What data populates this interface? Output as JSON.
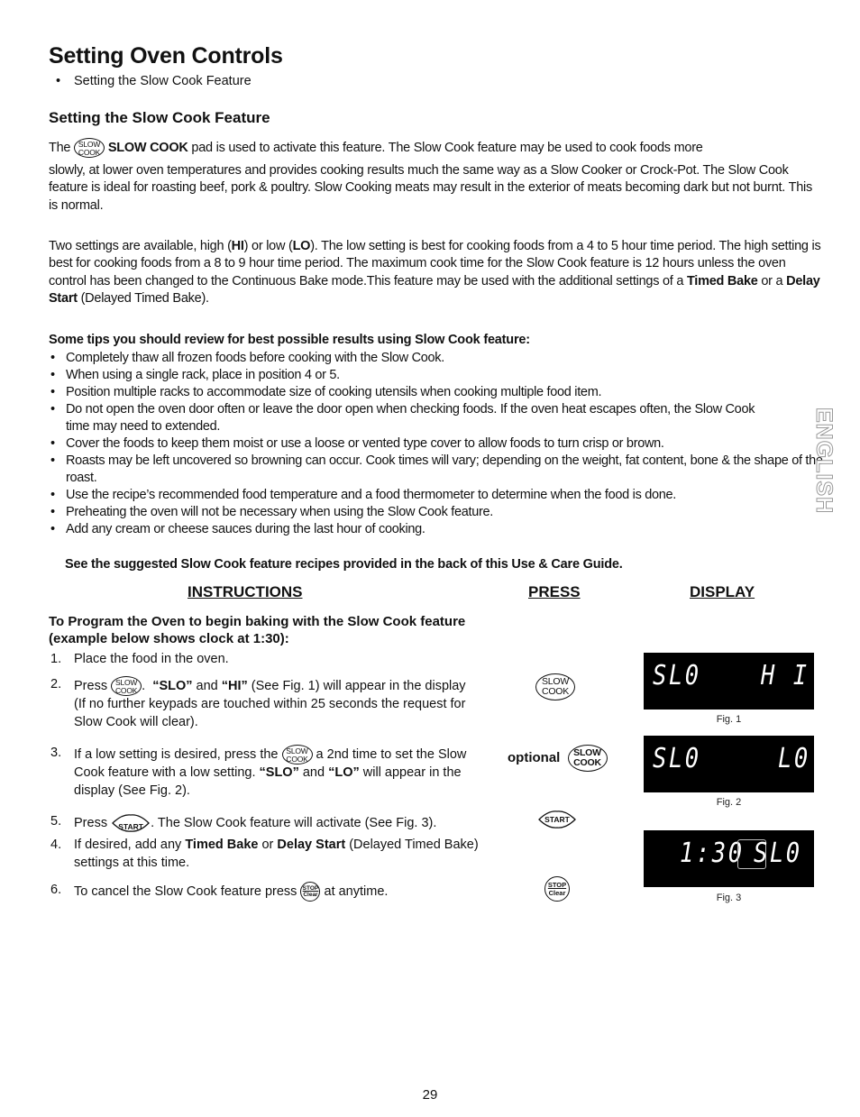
{
  "header": {
    "title": "Setting Oven Controls",
    "toc": [
      "Setting the Slow Cook Feature"
    ]
  },
  "section": {
    "heading": "Setting the Slow Cook Feature",
    "intro": {
      "pre": "The",
      "pad_label": "SLOW COOK",
      "rest_line1": "pad is used to activate this feature. The Slow Cook feature may be used to cook foods more",
      "rest": "slowly, at lower oven temperatures and provides cooking results much the same way as a Slow Cooker or Crock-Pot. The Slow Cook feature is ideal for roasting beef, pork & poultry. Slow Cooking meats may result in the exterior of meats becoming dark but not burnt. This is normal."
    },
    "settings_para": {
      "s1": "Two settings are available, high (",
      "hi": "HI",
      "s2": ")  or low (",
      "lo": "LO",
      "s3": "). The low setting is best for cooking foods from a 4 to 5 hour time period. The high setting is best for cooking foods from a 8 to 9 hour time period. The maximum cook time for the Slow Cook feature is 12 hours unless the oven control has been changed to the Continuous Bake mode.This feature may be used with the additional settings of a ",
      "timed_bake": "Timed Bake",
      "s4": " or a ",
      "delay_start": "Delay Start",
      "s5": " (Delayed Timed Bake)."
    },
    "tips_heading": "Some tips you should review for best possible results using Slow Cook feature:",
    "tips": [
      "Completely thaw all frozen foods before cooking with the Slow Cook.",
      "When using a single rack, place in position 4 or 5.",
      "Position multiple racks to accommodate size of cooking utensils when cooking multiple food item.",
      "Do not open the oven door often or leave the door open when checking foods. If the oven heat escapes often, the Slow Cook time may need to extended.",
      "Cover the foods to keep them moist or use a loose or vented type cover to allow foods to turn crisp or brown.",
      "Roasts may be left uncovered so browning can occur. Cook times will vary; depending on the weight, fat content, bone & the shape of the roast.",
      "Use the recipe’s recommended food temperature and a food thermometer to determine when the food is done.",
      "Preheating the oven will not be necessary when using the Slow Cook feature.",
      "Add any cream or cheese sauces during the last hour of cooking."
    ],
    "recipes_note": "See the suggested Slow Cook feature recipes provided in the back of this Use & Care Guide."
  },
  "table": {
    "col_instructions": "INSTRUCTIONS",
    "col_press": "PRESS",
    "col_display": "DISPLAY",
    "program_heading": "To Program the Oven to begin baking with the Slow Cook feature (example below shows clock at 1:30):",
    "steps": [
      {
        "num": "1.",
        "text": "Place the food in the oven."
      },
      {
        "num": "2.",
        "pre": "Press",
        "mid": ".",
        "q1": "“SLO”",
        "and": " and ",
        "q2": "“HI”",
        "post": " (See Fig. 1) will appear in the display (If no further keypads are touched within 25 seconds the request for Slow Cook will clear)."
      },
      {
        "num": "3.",
        "pre": "If a low setting is desired, press the",
        "post1": "a 2nd time to set the Slow Cook feature with a low setting.",
        "q1": "“SLO”",
        "and": " and ",
        "q2": "“LO”",
        "post2": " will appear in the display (See Fig. 2)."
      },
      {
        "num": "5.",
        "pre": "Press",
        "post": ". The Slow Cook feature will activate (See Fig. 3)."
      },
      {
        "num": "4.",
        "pre": "If desired, add any ",
        "tb": "Timed Bake",
        "or": " or ",
        "ds": "Delay Start",
        "post": " (Delayed Timed Bake) settings at this time."
      },
      {
        "num": "6.",
        "pre": "To cancel the Slow Cook feature press",
        "post": "at anytime."
      }
    ],
    "optional_label": "optional"
  },
  "keypads": {
    "slow_top": "SLOW",
    "slow_bottom": "COOK",
    "start": "START",
    "stop_top": "STOP",
    "stop_bottom": "Clear"
  },
  "displays": [
    {
      "left": "SL0",
      "right": "H I",
      "caption": "Fig. 1"
    },
    {
      "left": "SL0",
      "right": "L0",
      "caption": "Fig. 2"
    },
    {
      "left": "1:30",
      "right": "SL0",
      "caption": "Fig. 3"
    }
  ],
  "side_tab": "ENGLISH",
  "page_number": "29"
}
